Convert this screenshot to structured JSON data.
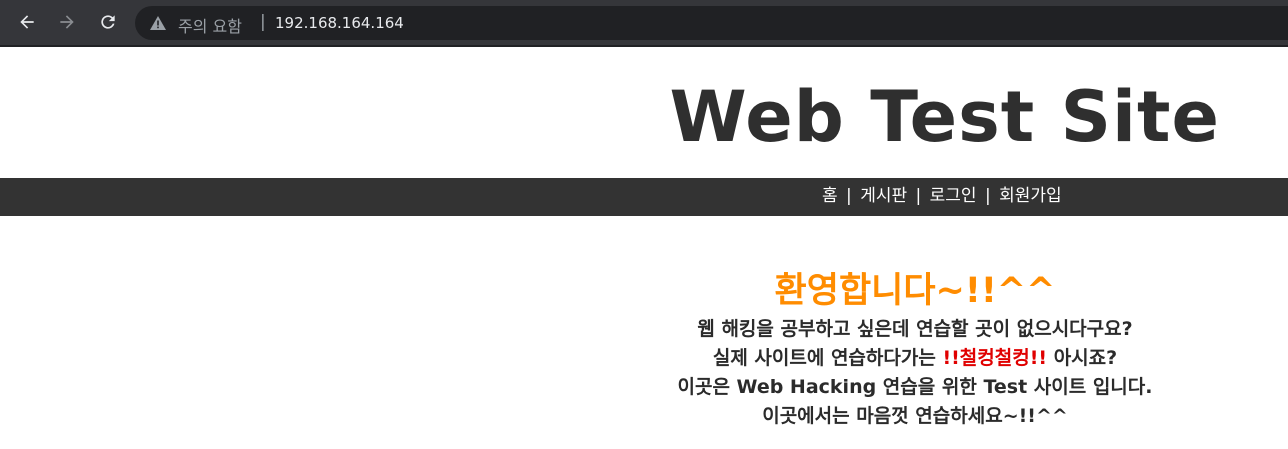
{
  "browser": {
    "security_label": "주의 요함",
    "separator": "|",
    "url": "192.168.164.164"
  },
  "site": {
    "title": "Web Test Site",
    "nav": {
      "home": "홈",
      "board": "게시판",
      "login": "로그인",
      "signup": "회원가입",
      "separator": "|"
    }
  },
  "content": {
    "welcome": "환영합니다~!!^^",
    "line1": "웹 해킹을 공부하고 싶은데 연습할 곳이 없으시다구요?",
    "line2_prefix": "실제 사이트에 연습하다가는",
    "line2_highlight": "!!철컹철컹!!",
    "line2_suffix": "아시죠?",
    "line3": "이곳은 Web Hacking 연습을 위한 Test 사이트 입니다.",
    "line4": "이곳에서는 마음껏 연습하세요~!!^^"
  },
  "colors": {
    "welcome": "#ff8c00",
    "highlight": "#e00000",
    "navbar": "#333333"
  }
}
